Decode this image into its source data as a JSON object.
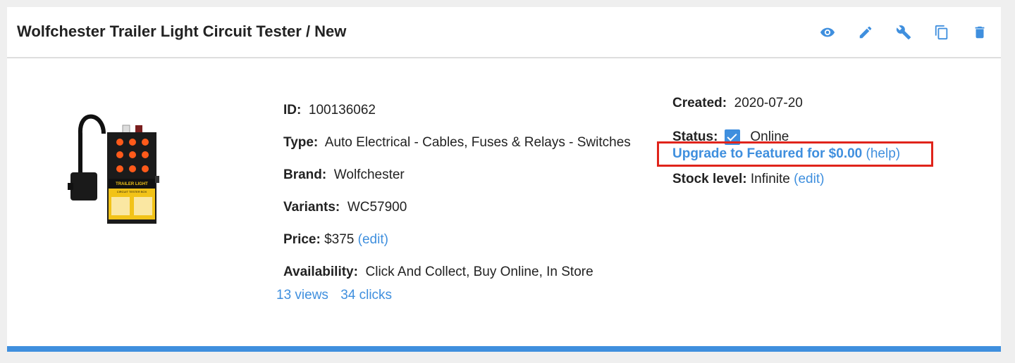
{
  "header": {
    "title": "Wolfchester Trailer Light Circuit Tester / New",
    "actions": [
      "eye-icon",
      "pencil-icon",
      "wrench-icon",
      "copy-icon",
      "trash-icon"
    ]
  },
  "product_image": {
    "lines": [
      "TRAILER LIGHT",
      "CIRCUIT TESTER BOX"
    ]
  },
  "details": {
    "id_label": "ID:",
    "id_value": "100136062",
    "type_label": "Type:",
    "type_value": "Auto Electrical - Cables, Fuses & Relays - Switches",
    "brand_label": "Brand:",
    "brand_value": "Wolfchester",
    "variants_label": "Variants:",
    "variants_value": "WC57900",
    "price_label": "Price:",
    "price_value": "$375",
    "price_edit": "(edit)",
    "availability_label": "Availability:",
    "availability_value": "Click And Collect, Buy Online, In Store"
  },
  "stats": {
    "views": "13 views",
    "clicks": "34 clicks"
  },
  "meta": {
    "created_label": "Created:",
    "created_value": "2020-07-20",
    "status_label": "Status:",
    "status_value": "Online",
    "status_checked": true,
    "upgrade_text": "Upgrade to Featured for $0.00",
    "help_text": "(help)",
    "stock_label": "Stock level:",
    "stock_value": "Infinite",
    "stock_edit": "(edit)"
  },
  "colors": {
    "accent": "#3f8fde",
    "highlight": "#e0241b",
    "background": "#efefef"
  }
}
